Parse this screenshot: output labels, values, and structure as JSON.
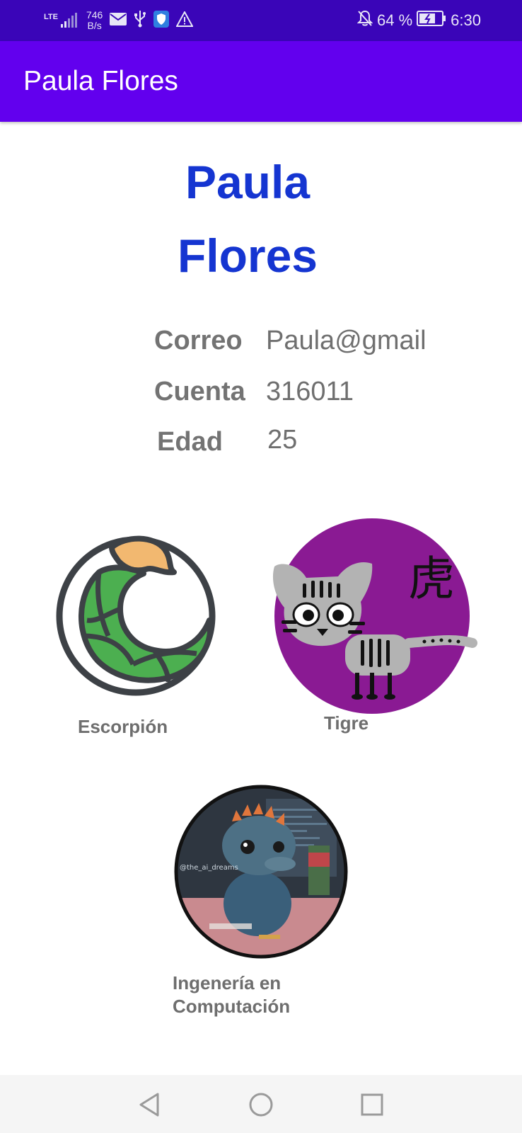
{
  "status_bar": {
    "network": "LTE",
    "speed_value": "746",
    "speed_unit": "B/s",
    "battery_percent": "64 %",
    "time": "6:30",
    "icons": [
      "signal-icon",
      "mail-icon",
      "usb-icon",
      "shield-icon",
      "warning-icon",
      "bell-off-icon",
      "battery-icon"
    ]
  },
  "app_bar": {
    "title": "Paula Flores"
  },
  "profile": {
    "name": "Paula Flores",
    "fields": [
      {
        "label": "Correo",
        "value": "Paula@gmail"
      },
      {
        "label": "Cuenta",
        "value": "316011"
      },
      {
        "label": "Edad",
        "value": "25"
      }
    ]
  },
  "images": {
    "zodiac": {
      "caption": "Escorpión"
    },
    "chinese_zodiac": {
      "caption": "Tigre",
      "glyph": "虎"
    },
    "career": {
      "caption": "Ingenería en Computación",
      "watermark": "@the_ai_dreams"
    }
  },
  "colors": {
    "status_bar": "#3a05b8",
    "app_bar": "#6200ee",
    "name_heading": "#1535d1",
    "tiger_circle": "#8a1a93"
  },
  "nav_bar": {
    "icons": [
      "back-icon",
      "home-icon",
      "recents-icon"
    ]
  }
}
